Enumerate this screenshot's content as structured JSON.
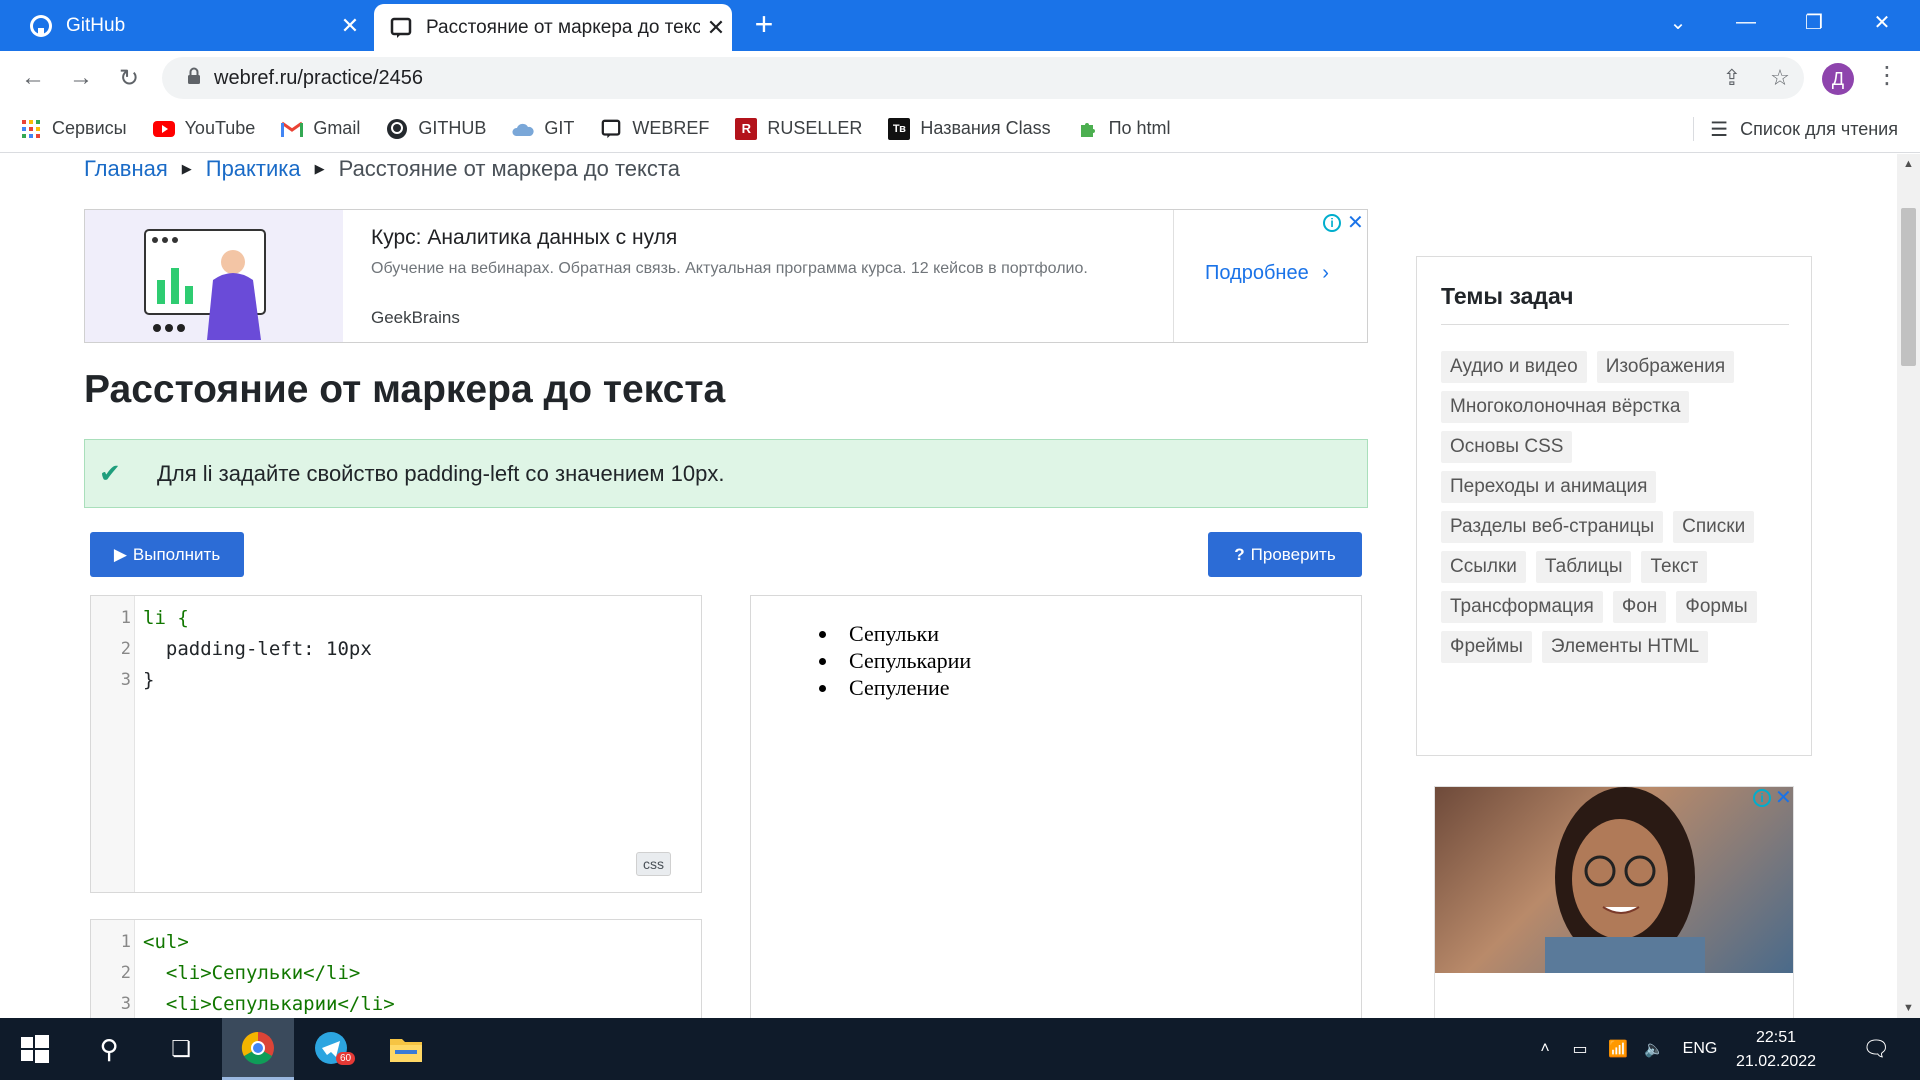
{
  "browser": {
    "tabs": [
      {
        "title": "GitHub",
        "active": false
      },
      {
        "title": "Расстояние от маркера до текста",
        "active": true
      }
    ],
    "new_tab": "+",
    "url": "webref.ru/practice/2456",
    "profile_initial": "Д",
    "bookmarks": [
      {
        "label": "Сервисы",
        "icon": "apps-grid-icon"
      },
      {
        "label": "YouTube",
        "icon": "youtube-icon"
      },
      {
        "label": "Gmail",
        "icon": "gmail-icon"
      },
      {
        "label": "GITHUB",
        "icon": "github-icon"
      },
      {
        "label": "GIT",
        "icon": "git-cloud-icon"
      },
      {
        "label": "WEBREF",
        "icon": "webref-icon"
      },
      {
        "label": "RUSELLER",
        "icon": "ruseller-icon"
      },
      {
        "label": "Названия Class",
        "icon": "tb-icon"
      },
      {
        "label": "По html",
        "icon": "puzzle-icon"
      }
    ],
    "reading_list": "Список для чтения"
  },
  "breadcrumb": {
    "home": "Главная",
    "section": "Практика",
    "current": "Расстояние от маркера до текста"
  },
  "ad_top": {
    "title": "Курс: Аналитика данных с нуля",
    "description": "Обучение на вебинарах. Обратная связь. Актуальная программа курса. 12 кейсов в портфолио.",
    "brand": "GeekBrains",
    "cta": "Подробнее"
  },
  "page_title": "Расстояние от маркера до текста",
  "task_text": "Для li задайте свойство padding-left со значением 10px.",
  "buttons": {
    "run": "Выполнить",
    "check": "Проверить"
  },
  "css_editor": {
    "lang": "css",
    "lines": [
      "li {",
      "  padding-left: 10px",
      "}"
    ]
  },
  "html_editor": {
    "lines": [
      "<ul>",
      "  <li>Сепульки</li>",
      "  <li>Сепулькарии</li>"
    ]
  },
  "preview_items": [
    "Сепульки",
    "Сепулькарии",
    "Сепуление"
  ],
  "sidebar": {
    "title": "Темы задач",
    "topics": [
      "Аудио и видео",
      "Изображения",
      "Многоколоночная вёрстка",
      "Основы CSS",
      "Переходы и анимация",
      "Разделы веб-страницы",
      "Списки",
      "Ссылки",
      "Таблицы",
      "Текст",
      "Трансформация",
      "Фон",
      "Формы",
      "Фреймы",
      "Элементы HTML"
    ]
  },
  "taskbar": {
    "language": "ENG",
    "time": "22:51",
    "date": "21.02.2022",
    "telegram_badge": "60"
  },
  "colors": {
    "chrome_blue": "#1a73e8",
    "link": "#1a6bc7",
    "button": "#2c6cd6",
    "success_bg": "#dff5e6",
    "success_check": "#1e9e7c"
  }
}
